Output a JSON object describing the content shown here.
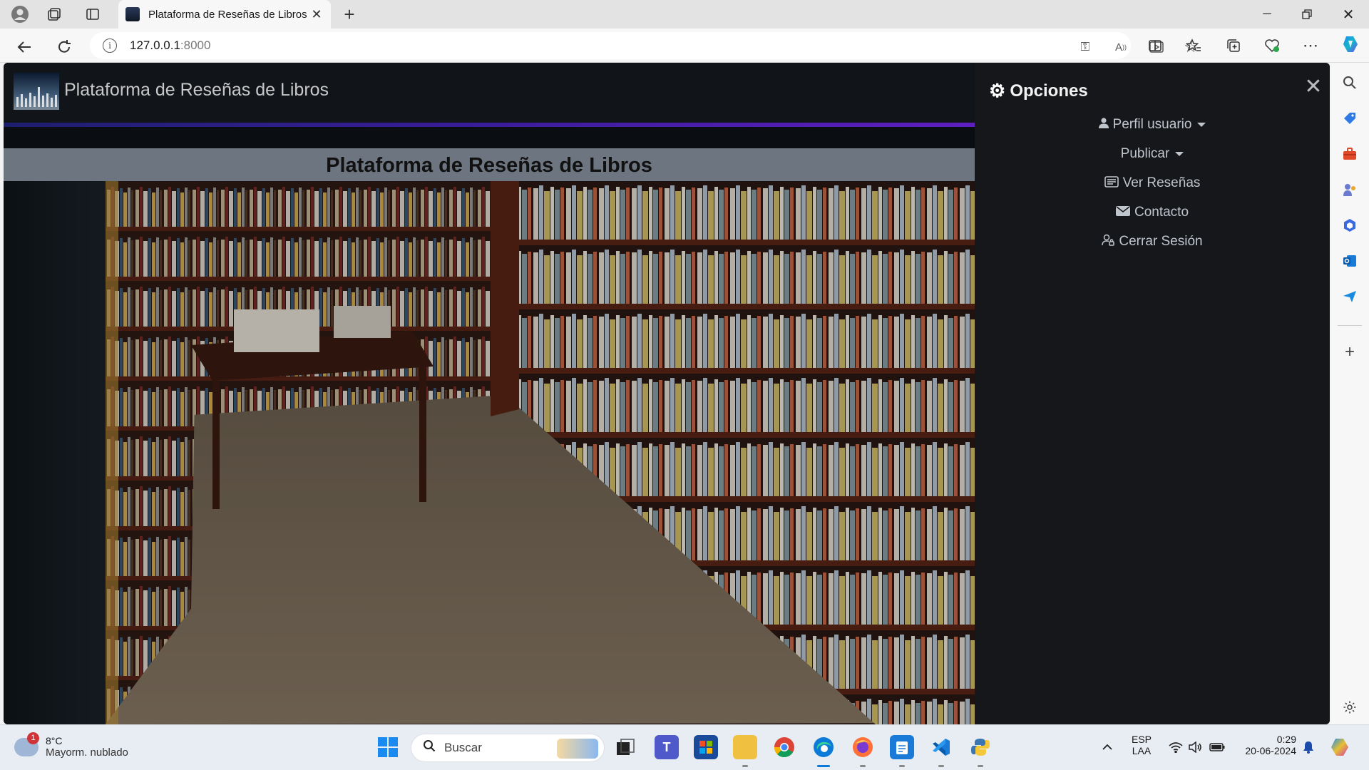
{
  "browser": {
    "tab_title": "Plataforma de Reseñas de Libros",
    "address_host": "127.0.0.1",
    "address_port": ":8000"
  },
  "site": {
    "brand": "Plataforma de Reseñas de Libros",
    "hero_title": "Plataforma de Reseñas de Libros"
  },
  "offcanvas": {
    "title": "Opciones",
    "items": [
      {
        "label": "Perfil usuario",
        "icon": "person-icon",
        "dropdown": true
      },
      {
        "label": "Publicar",
        "icon": "",
        "dropdown": true
      },
      {
        "label": "Ver Reseñas",
        "icon": "card-text-icon",
        "dropdown": false
      },
      {
        "label": "Contacto",
        "icon": "envelope-icon",
        "dropdown": false
      },
      {
        "label": "Cerrar Sesión",
        "icon": "person-lock-icon",
        "dropdown": false
      }
    ]
  },
  "taskbar": {
    "weather_temp": "8°C",
    "weather_desc": "Mayorm. nublado",
    "weather_badge": "1",
    "search_placeholder": "Buscar",
    "lang_top": "ESP",
    "lang_bottom": "LAA",
    "time": "0:29",
    "date": "20-06-2024"
  },
  "colors": {
    "accent_purple": "#5e1fc0",
    "offcanvas_bg": "#15171b",
    "hero_header_bg": "#6c7580"
  }
}
